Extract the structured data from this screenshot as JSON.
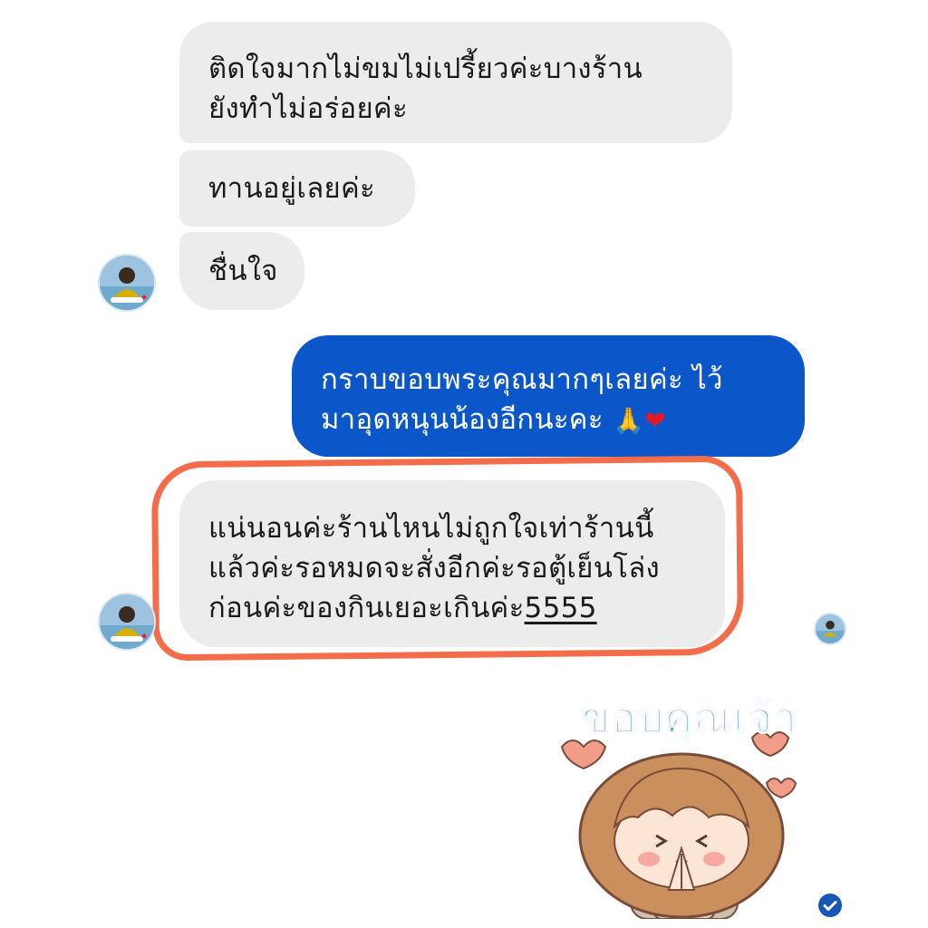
{
  "conversation": {
    "incoming_1": {
      "line1": "ติดใจมากไม่ขมไม่เปรี้ยวค่ะบางร้าน",
      "line2": "ยังทำไม่อร่อยค่ะ"
    },
    "incoming_2": {
      "text": "ทานอยู่เลยค่ะ"
    },
    "incoming_3": {
      "text": "ชื่นใจ"
    },
    "outgoing_1": {
      "line1": "กราบขอบพระคุณมากๆเลยค่ะ ไว้",
      "line2": "มาอุดหนุนน้องอีกนะคะ ",
      "emoji_pray": "🙏",
      "emoji_heart": "❤"
    },
    "incoming_4": {
      "line1": "แน่นอนค่ะร้านไหนไม่ถูกใจเท่าร้านนี้",
      "line2": "แล้วค่ะรอหมดจะสั่งอีกค่ะรอตู้เย็นโล่ง",
      "line3_prefix": "ก่อนค่ะของกินเยอะเกินค่ะ",
      "line3_link": "5555"
    },
    "sticker": {
      "text": "ขอบคุณเจ้า"
    }
  },
  "colors": {
    "incoming_bubble": "#ececec",
    "outgoing_bubble": "#0b57c9",
    "highlight_stroke": "#f36d4a",
    "read_check": "#1855b8"
  },
  "icons": {
    "sender_avatar": "profile-photo-avatar",
    "seen_avatar": "seen-indicator-avatar",
    "read_receipt": "check-circle-icon"
  }
}
